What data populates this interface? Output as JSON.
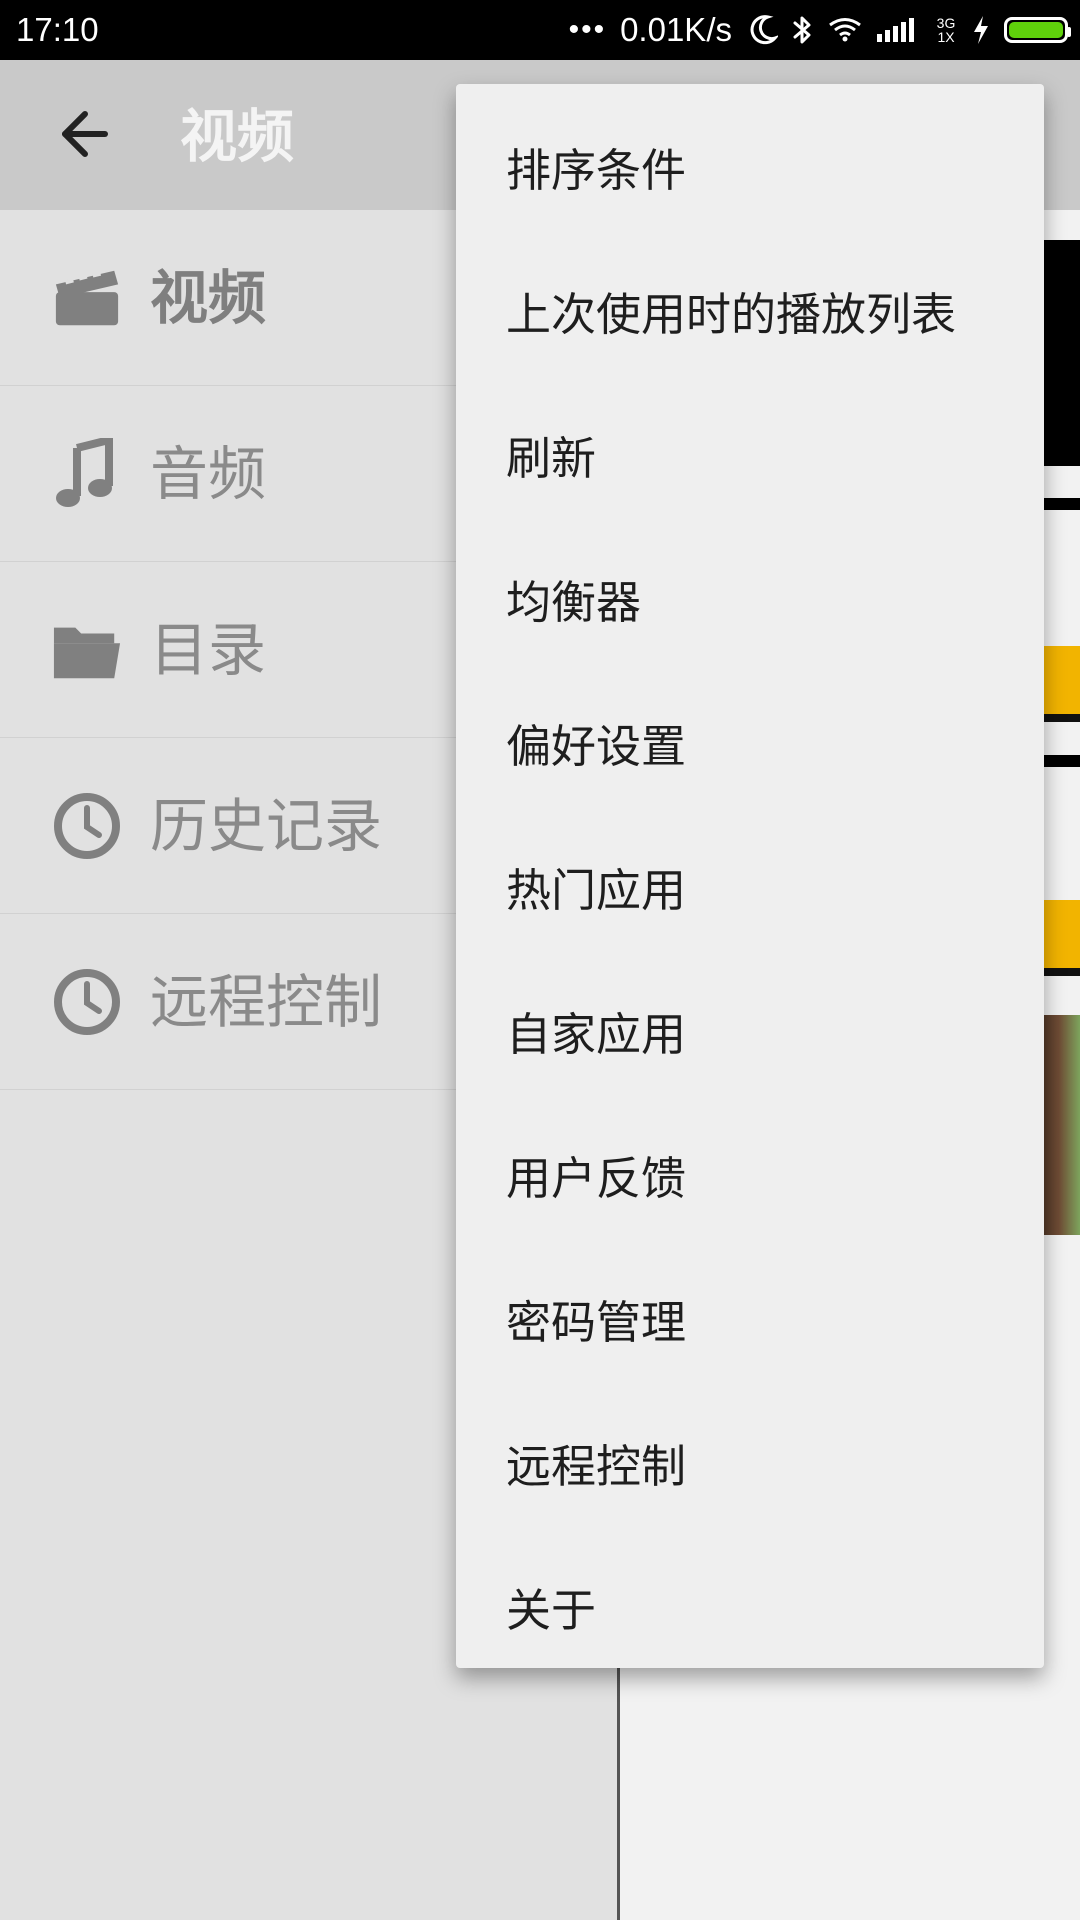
{
  "status_bar": {
    "time": "17:10",
    "dots": "•••",
    "speed": "0.01K/s",
    "network_label": "3G 1X"
  },
  "app_bar": {
    "back_icon": "arrow-back-icon",
    "title": "视频"
  },
  "drawer": {
    "items": [
      {
        "label": "视频",
        "icon": "film-clapper-icon",
        "active": true
      },
      {
        "label": "音频",
        "icon": "music-note-icon",
        "active": false
      },
      {
        "label": "目录",
        "icon": "folder-icon",
        "active": false
      },
      {
        "label": "历史记录",
        "icon": "clock-icon",
        "active": false
      },
      {
        "label": "远程控制",
        "icon": "clock-icon",
        "active": false
      }
    ]
  },
  "overflow_menu": {
    "items": [
      "排序条件",
      "上次使用时的播放列表",
      "刷新",
      "均衡器",
      "偏好设置",
      "热门应用",
      "自家应用",
      "用户反馈",
      "密码管理",
      "远程控制",
      "关于"
    ]
  },
  "colors": {
    "status_bar": "#000000",
    "app_bar": "#c9c9c9",
    "drawer_background": "#e1e1e1",
    "menu_background": "#efefef",
    "accent_yellow": "#f2b400",
    "battery_green": "#5fd10b"
  }
}
